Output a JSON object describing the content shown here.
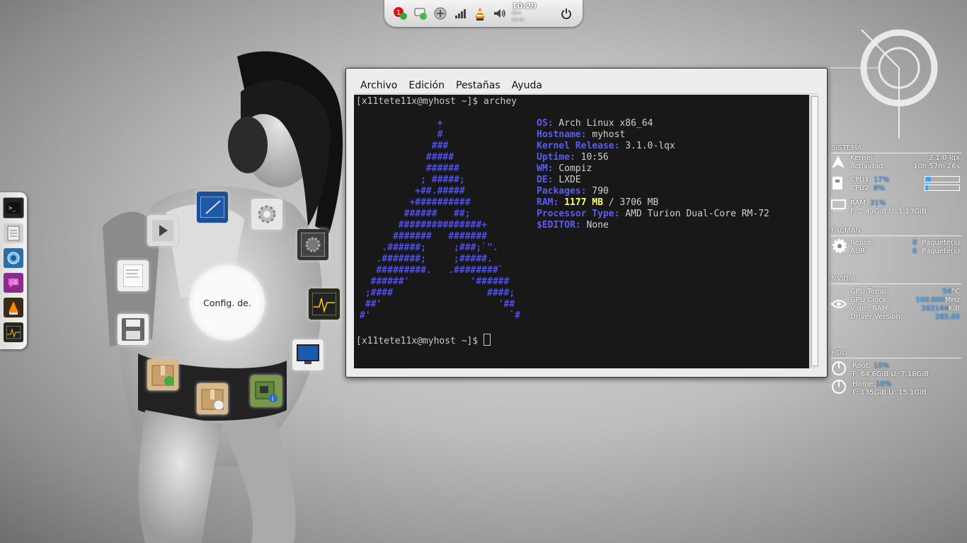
{
  "tray": {
    "badge": "1",
    "clock_time": "10:29",
    "clock_date": "dom\n09:10"
  },
  "dock": {
    "items": [
      "terminal-icon",
      "file-manager-icon",
      "browser-icon",
      "chat-icon",
      "vlc-icon",
      "system-monitor-icon"
    ]
  },
  "launcher": {
    "center_label": "Config. de."
  },
  "terminal": {
    "menu": [
      "Archivo",
      "Edición",
      "Pestañas",
      "Ayuda"
    ],
    "prompt_cmd": "[x11tete11x@myhost ~]$ archey",
    "prompt_end": "[x11tete11x@myhost ~]$ ",
    "logo": [
      "              +",
      "              #",
      "             ###",
      "            #####",
      "            ######",
      "           ; #####;",
      "          +##.#####",
      "         +##########",
      "        ######   ##;",
      "       ###############+",
      "      #######   #######",
      "    .######;     ;###;`\".",
      "   .#######;     ;#####.",
      "   #########.   .########`",
      "  ######'           '######",
      " ;####                 ####;",
      " ##'                     '##",
      "#'                         `#"
    ],
    "info": [
      {
        "k": "OS:",
        "v": " Arch Linux x86_64"
      },
      {
        "k": "Hostname:",
        "v": " myhost"
      },
      {
        "k": "Kernel Release:",
        "v": " 3.1.0-lqx"
      },
      {
        "k": "Uptime:",
        "v": " 10:56"
      },
      {
        "k": "WM:",
        "v": " Compiz"
      },
      {
        "k": "DE:",
        "v": " LXDE"
      },
      {
        "k": "Packages:",
        "v": " 790"
      },
      {
        "k": "RAM:",
        "v": " / 3706 MB",
        "hl": " 1177 MB"
      },
      {
        "k": "Processor Type:",
        "v": " AMD Turion Dual-Core RM-72"
      },
      {
        "k": "$EDITOR:",
        "v": " None"
      }
    ]
  },
  "conky": {
    "sistema": {
      "title": "SISTEMA",
      "kernel_label": "Kernel:",
      "kernel_value": "3.1.0-lqx",
      "uptime_label": "Actividad:",
      "uptime_value": "10h 57m 26s",
      "cpu1_label": "CPU1:",
      "cpu1_value": "17%",
      "cpu2_label": "CPU2:",
      "cpu2_value": "8%",
      "cpu1_level": 0.17,
      "cpu2_level": 0.08,
      "ram_label": "RAM:",
      "ram_value": "31%",
      "ram_detail": "F: 2.49GiB U: 1.13GiB"
    },
    "pacman": {
      "title": "PACMAN",
      "repos_label": "Repos:",
      "repos_value": "0",
      "repos_unit": "Paquete(s)",
      "aur_label": "AUR:",
      "aur_value": "0",
      "aur_unit": "Paquete(s)"
    },
    "nvidia": {
      "title": "NVIDIA",
      "temp_label": "GPU Temp:",
      "temp_value": "54",
      "temp_unit": "°C",
      "clock_label": "GPU Clock:",
      "clock_value": "100.000",
      "clock_unit": "MHz",
      "vram_label": "Video RAM:",
      "vram_value": "262144",
      "vram_unit": "KiB",
      "driver_label": "Driver Version:",
      "driver_value": "285.05"
    },
    "hdd": {
      "title": "HDD",
      "root_label": "Root:",
      "root_value": "10%",
      "root_detail": "F: 64.6GiB U: 7.18GiB",
      "home_label": "Home:",
      "home_value": "10%",
      "home_detail": "F: 135GiB U: 15.1GiB"
    }
  }
}
